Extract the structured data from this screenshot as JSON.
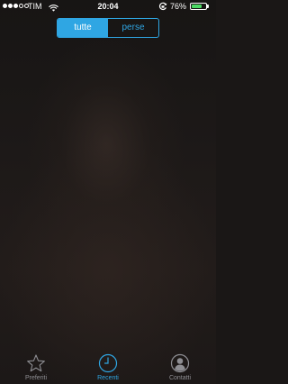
{
  "status_bar": {
    "carrier": "TIM",
    "time": "20:04",
    "battery_percent_text": "76%",
    "battery_level": 0.76,
    "signal_bars_filled": 3,
    "signal_bars_total": 5,
    "battery_color": "#4cd964"
  },
  "segmented_control": {
    "options": [
      "tutte",
      "perse"
    ],
    "selected": "tutte",
    "accent_color": "#2fa6e3"
  },
  "tab_bar": {
    "items": [
      {
        "label": "Preferiti",
        "icon": "star-icon",
        "active": false
      },
      {
        "label": "Recenti",
        "icon": "clock-icon",
        "active": true
      },
      {
        "label": "Contatti",
        "icon": "contact-icon",
        "active": false
      }
    ]
  }
}
